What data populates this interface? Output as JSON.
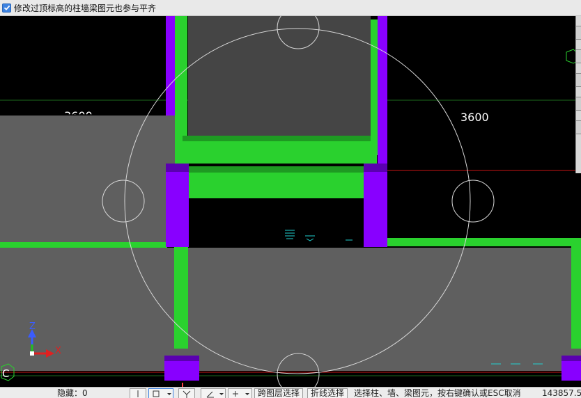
{
  "topbar": {
    "checkbox_checked": true,
    "label": "修改过顶标高的柱墙梁图元也参与平齐"
  },
  "canvas": {
    "dimension_left": "3600",
    "dimension_right": "3600",
    "axis_label": "C",
    "axis_z": "Z",
    "axis_x": "X"
  },
  "colors": {
    "slab_gray": "#5f5f5f",
    "beam_green": "#2ad12e",
    "beam_green_dark": "#1e9a22",
    "column_purple": "#8800ff",
    "column_purple_dark": "#5a00b0",
    "cursor_circle": "#d8d8d8",
    "grid_red": "#c81414",
    "rebar_cyan": "#20d0d0"
  },
  "statusbar": {
    "hidden_label": "隐藏：0",
    "layer_select_button": "跨图层选择",
    "polyline_select_button": "折线选择",
    "hint": "选择柱、墙、梁图元，按右键确认或ESC取消",
    "coordinates": "143857.5"
  }
}
